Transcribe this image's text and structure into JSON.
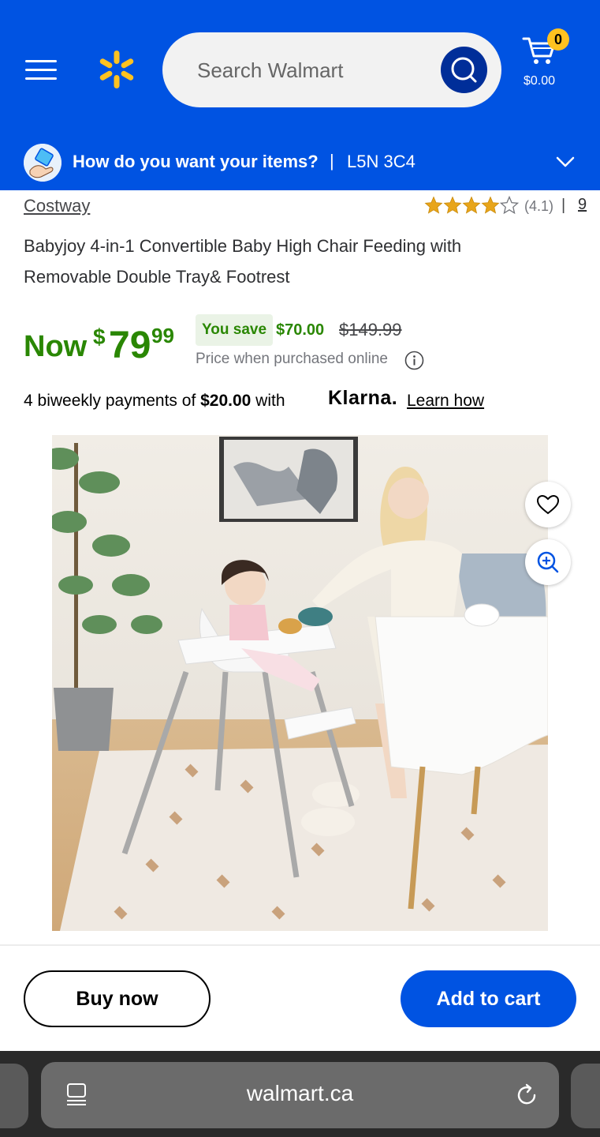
{
  "header": {
    "search_placeholder": "Search Walmart",
    "cart_count": "0",
    "cart_total": "$0.00"
  },
  "fulfillment": {
    "prompt": "How do you want your items?",
    "separator": "|",
    "postal_code": "L5N 3C4"
  },
  "product": {
    "brand": "Costway",
    "rating_value": 4.1,
    "rating_text": "(4.1)",
    "rating_sep": "|",
    "review_count": "9",
    "title": "Babyjoy 4-in-1 Convertible Baby High Chair Feeding with Removable Double Tray& Footrest",
    "now_label": "Now",
    "price_currency": "$",
    "price_dollars": "79",
    "price_cents": "99",
    "you_save_label": "You save",
    "save_amount": "$70.00",
    "was_price": "$149.99",
    "price_note": "Price when purchased online"
  },
  "payment": {
    "prefix": "4 biweekly payments of ",
    "amount": "$20.00",
    "suffix": " with",
    "provider": "Klarna.",
    "learn_link": "Learn how"
  },
  "actions": {
    "buy_now": "Buy now",
    "add_to_cart": "Add to cart"
  },
  "browser": {
    "url": "walmart.ca"
  },
  "colors": {
    "walmart_blue": "#0053e2",
    "spark_yellow": "#ffc220",
    "price_green": "#2a8703"
  },
  "icons": [
    "menu-icon",
    "walmart-spark-logo",
    "search-icon",
    "cart-icon",
    "delivery-icon",
    "chevron-down-icon",
    "star-icon",
    "info-icon",
    "heart-icon",
    "zoom-in-icon",
    "page-menu-icon",
    "reload-icon"
  ]
}
